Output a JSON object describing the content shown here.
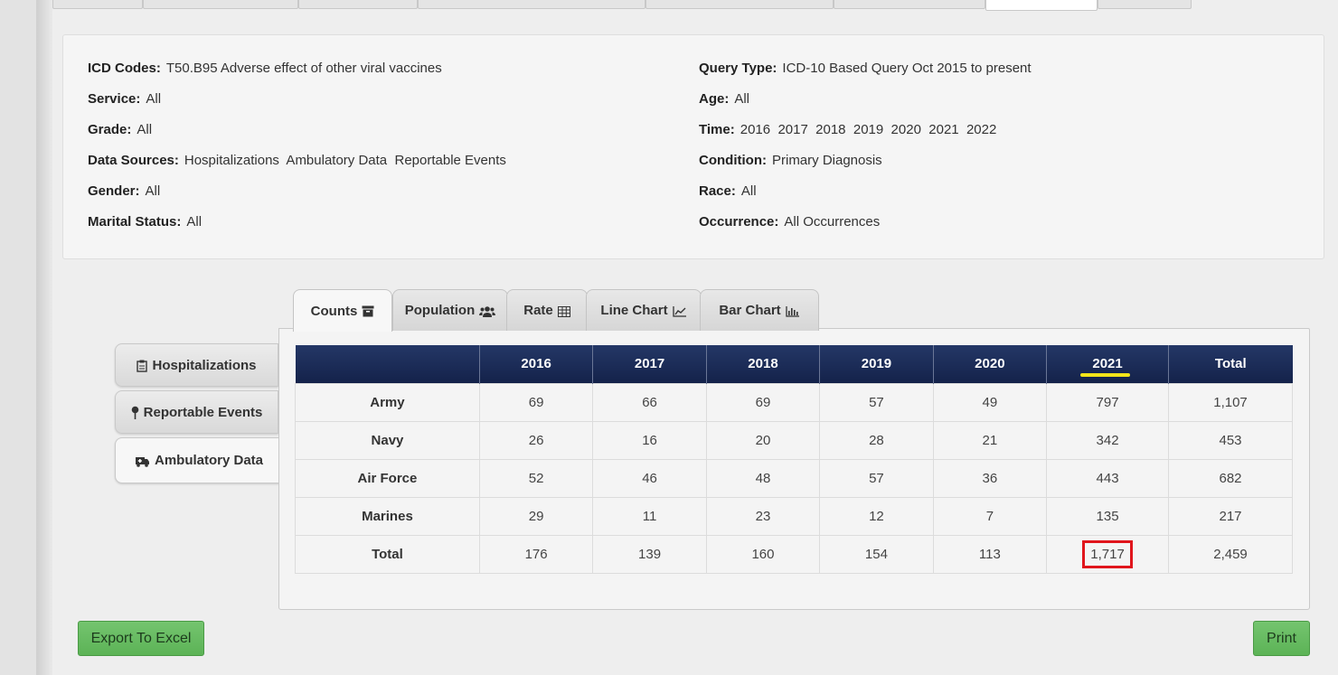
{
  "info": {
    "left": [
      {
        "label": "ICD Codes:",
        "value": "T50.B95 Adverse effect of other viral vaccines"
      },
      {
        "label": "Service:",
        "value": "All"
      },
      {
        "label": "Grade:",
        "value": "All"
      },
      {
        "label": "Data Sources:",
        "value": "Hospitalizations  Ambulatory Data  Reportable Events"
      },
      {
        "label": "Gender:",
        "value": "All"
      },
      {
        "label": "Marital Status:",
        "value": "All"
      }
    ],
    "right": [
      {
        "label": "Query Type:",
        "value": "ICD-10 Based Query Oct 2015 to present"
      },
      {
        "label": "Age:",
        "value": "All"
      },
      {
        "label": "Time:",
        "value": "2016  2017  2018  2019  2020  2021  2022"
      },
      {
        "label": "Condition:",
        "value": "Primary Diagnosis"
      },
      {
        "label": "Race:",
        "value": "All"
      },
      {
        "label": "Occurrence:",
        "value": "All Occurrences"
      }
    ]
  },
  "source_tabs": [
    {
      "label": "Hospitalizations",
      "icon": "clipboard-icon"
    },
    {
      "label": "Reportable Events",
      "icon": "map-pin-icon"
    },
    {
      "label": "Ambulatory Data",
      "icon": "ambulance-icon"
    }
  ],
  "view_tabs": [
    {
      "label": "Counts",
      "icon": "archive-icon"
    },
    {
      "label": "Population",
      "icon": "users-icon"
    },
    {
      "label": "Rate",
      "icon": "table-icon"
    },
    {
      "label": "Line Chart",
      "icon": "line-chart-icon"
    },
    {
      "label": "Bar Chart",
      "icon": "bar-chart-icon"
    }
  ],
  "table": {
    "headers": [
      "",
      "2016",
      "2017",
      "2018",
      "2019",
      "2020",
      "2021",
      "Total"
    ],
    "rows": [
      {
        "name": "Army",
        "values": [
          "69",
          "66",
          "69",
          "57",
          "49",
          "797",
          "1,107"
        ]
      },
      {
        "name": "Navy",
        "values": [
          "26",
          "16",
          "20",
          "28",
          "21",
          "342",
          "453"
        ]
      },
      {
        "name": "Air Force",
        "values": [
          "52",
          "46",
          "48",
          "57",
          "36",
          "443",
          "682"
        ]
      },
      {
        "name": "Marines",
        "values": [
          "29",
          "11",
          "23",
          "12",
          "7",
          "135",
          "217"
        ]
      },
      {
        "name": "Total",
        "values": [
          "176",
          "139",
          "160",
          "154",
          "113",
          "1,717",
          "2,459"
        ]
      }
    ]
  },
  "buttons": {
    "export": "Export To Excel",
    "print": "Print"
  },
  "colors": {
    "header_navy": "#1b2b55",
    "highlight_red": "#e0151c",
    "underline_yellow": "#f2e41a",
    "button_green": "#5cb85c"
  }
}
